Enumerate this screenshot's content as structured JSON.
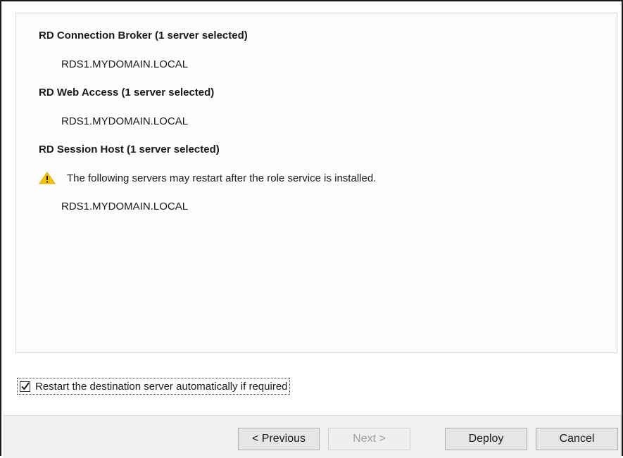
{
  "sections": [
    {
      "title": "RD Connection Broker  (1 server selected)",
      "server": "RDS1.MYDOMAIN.LOCAL"
    },
    {
      "title": "RD Web Access  (1 server selected)",
      "server": "RDS1.MYDOMAIN.LOCAL"
    },
    {
      "title": "RD Session Host  (1 server selected)",
      "warning": "The following servers may restart after the role service is installed.",
      "server": "RDS1.MYDOMAIN.LOCAL"
    }
  ],
  "restart_option": {
    "label": "Restart the destination server automatically if required",
    "checked": true
  },
  "buttons": {
    "previous": "< Previous",
    "next": "Next >",
    "deploy": "Deploy",
    "cancel": "Cancel"
  },
  "colors": {
    "warning_fill": "#f5c400",
    "warning_mark": "#1a1a1a"
  },
  "icons": {
    "warning": "warning-triangle-icon",
    "check": "checkmark-icon"
  }
}
